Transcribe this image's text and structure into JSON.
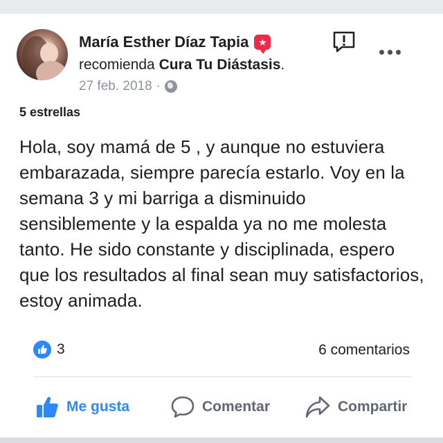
{
  "post": {
    "author": "María Esther Díaz Tapia",
    "recommend_verb": "recomienda",
    "page_name": "Cura Tu Diástasis",
    "recommend_end": ".",
    "date": "27 feb. 2018",
    "date_separator": "·",
    "rating": "5 estrellas",
    "body": "Hola, soy mamá de 5 , y aunque no estuviera embarazada, siempre parecía estarlo. Voy en la semana 3 y mi barriga a disminuido sensiblemente y la espalda ya no me molesta tanto. He sido constante y disciplinada, espero que los resultados al final sean muy satisfactorios, estoy animada."
  },
  "stats": {
    "likes": "3",
    "comments": "6 comentarios"
  },
  "actions": {
    "like_label": "Me gusta",
    "comment_label": "Comentar",
    "share_label": "Compartir"
  },
  "icons": {
    "recommend_badge": "star-badge-icon",
    "report": "report-icon",
    "more": "more-options-icon",
    "privacy": "globe-icon",
    "like_reaction": "like-reaction-icon",
    "like": "thumbs-up-icon",
    "comment": "comment-bubble-icon",
    "share": "share-arrow-icon"
  },
  "colors": {
    "accent": "#2d88ff",
    "badge": "#f0284a",
    "muted_text": "#8d949e",
    "action_text": "#606770"
  }
}
